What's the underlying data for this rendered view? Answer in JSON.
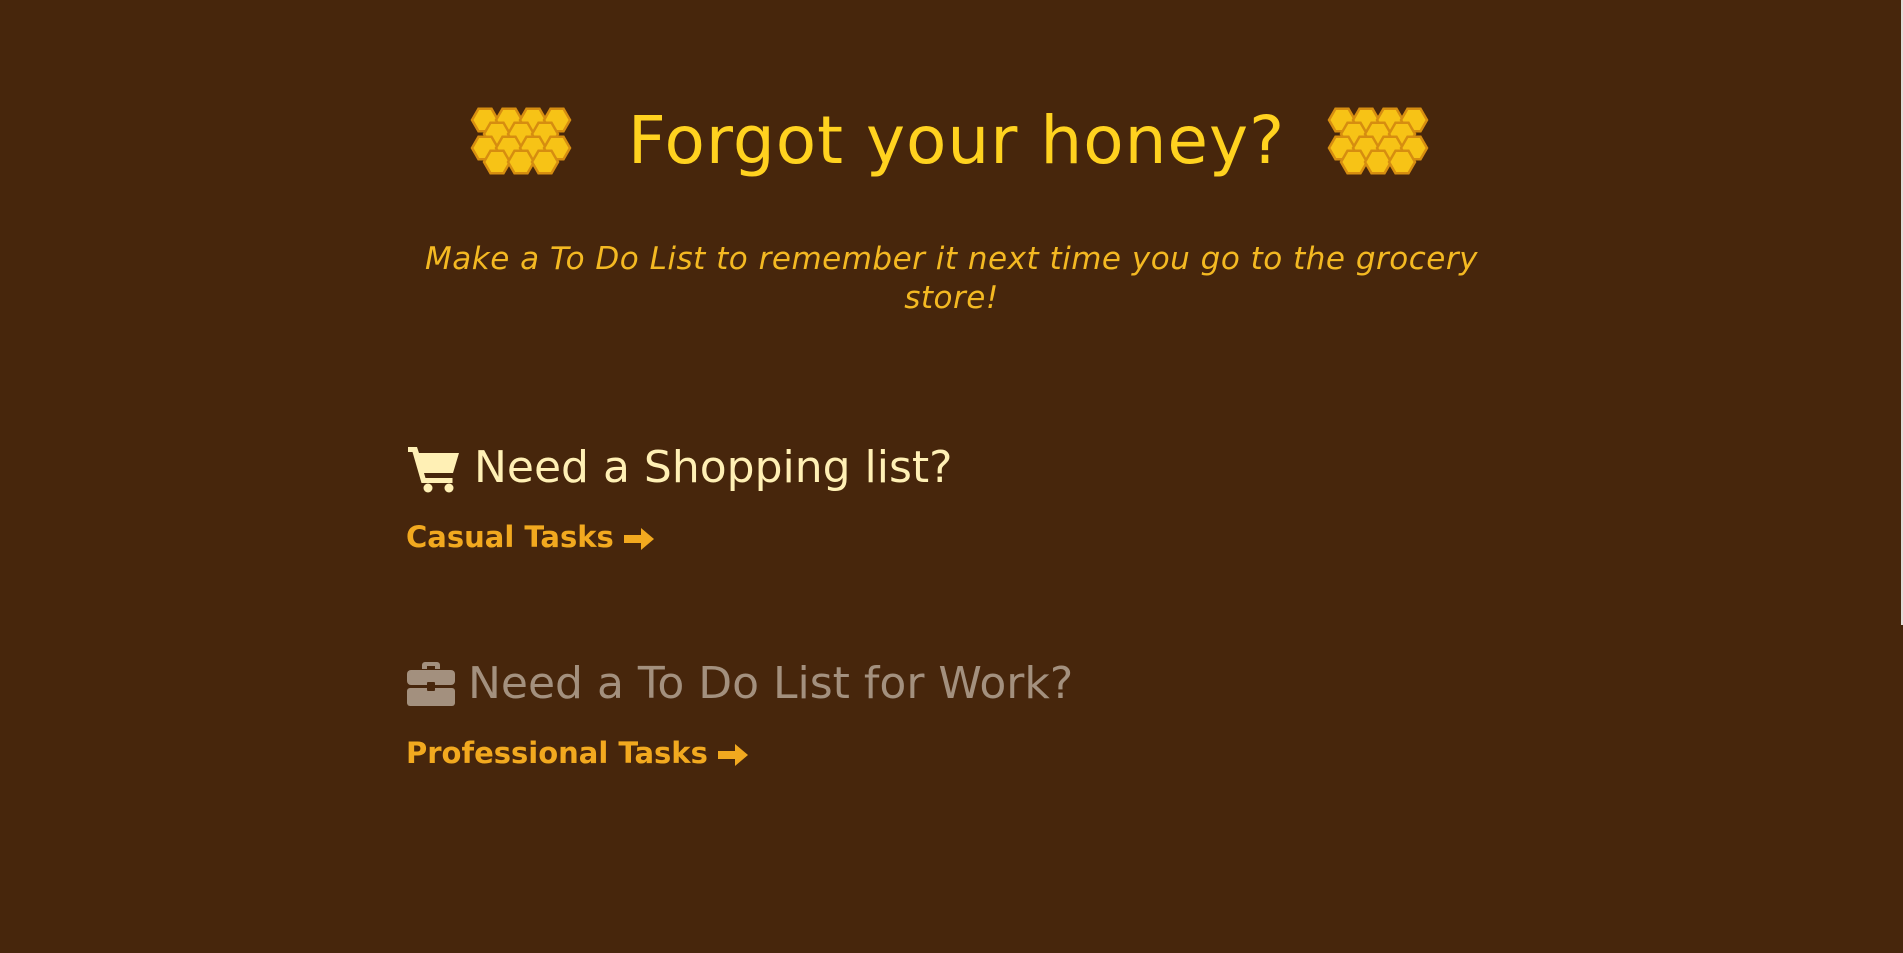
{
  "header": {
    "title": "Forgot your honey?",
    "left_icon": "honeycomb-icon",
    "right_icon": "honeycomb-icon"
  },
  "subtitle": "Make a To Do List to remember it next time you go to the grocery store!",
  "sections": [
    {
      "icon": "shopping-cart-icon",
      "title": "Need a Shopping list?",
      "link_label": "Casual Tasks",
      "link_icon": "arrow-right-icon"
    },
    {
      "icon": "briefcase-icon",
      "title": "Need a To Do List for Work?",
      "link_label": "Professional Tasks",
      "link_icon": "arrow-right-icon"
    }
  ],
  "colors": {
    "background": "#47260c",
    "title": "#ffd21f",
    "subtitle": "#f4b922",
    "shopping_heading": "#fff0b5",
    "work_heading": "#a3907e",
    "link": "#f2a91f",
    "honeycomb_fill": "#f7c316",
    "honeycomb_stroke": "#d68d10"
  }
}
